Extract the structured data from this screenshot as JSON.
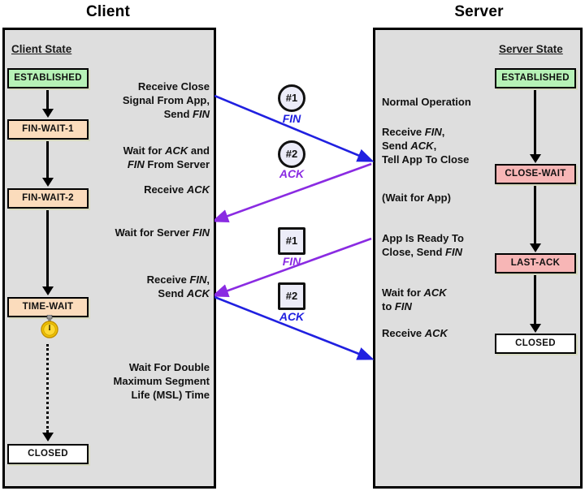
{
  "titles": {
    "client": "Client",
    "server": "Server"
  },
  "headings": {
    "client_state": "Client State",
    "server_state": "Server State"
  },
  "client_states": [
    {
      "label": "ESTABLISHED"
    },
    {
      "label": "FIN-WAIT-1"
    },
    {
      "label": "FIN-WAIT-2"
    },
    {
      "label": "TIME-WAIT"
    },
    {
      "label": "CLOSED"
    }
  ],
  "server_states": [
    {
      "label": "ESTABLISHED"
    },
    {
      "label": "CLOSE-WAIT"
    },
    {
      "label": "LAST-ACK"
    },
    {
      "label": "CLOSED"
    }
  ],
  "client_notes": [
    {
      "lines": [
        "Receive Close",
        "Signal From App,",
        "Send FIN"
      ]
    },
    {
      "lines": [
        "Wait for ACK and",
        "FIN From Server"
      ]
    },
    {
      "lines": [
        "Receive ACK"
      ]
    },
    {
      "lines": [
        "Wait for Server FIN"
      ]
    },
    {
      "lines": [
        "Receive FIN,",
        "Send ACK"
      ]
    },
    {
      "lines": [
        "Wait For Double",
        "Maximum Segment",
        "Life (MSL) Time"
      ]
    }
  ],
  "server_notes": [
    {
      "lines": [
        "Normal Operation"
      ]
    },
    {
      "lines": [
        "Receive FIN,",
        "Send ACK,",
        "Tell App To Close"
      ]
    },
    {
      "lines": [
        "(Wait for App)"
      ]
    },
    {
      "lines": [
        "App Is Ready To",
        "Close, Send FIN"
      ]
    },
    {
      "lines": [
        "Wait for ACK",
        "to FIN"
      ]
    },
    {
      "lines": [
        "Receive ACK"
      ]
    }
  ],
  "messages": [
    {
      "marker": "#1",
      "label": "FIN",
      "shape": "circle",
      "direction": "client-to-server",
      "color": "#2020e0"
    },
    {
      "marker": "#2",
      "label": "ACK",
      "shape": "circle",
      "direction": "server-to-client",
      "color": "#8a2be2"
    },
    {
      "marker": "#1",
      "label": "FIN",
      "shape": "square",
      "direction": "server-to-client",
      "color": "#8a2be2"
    },
    {
      "marker": "#2",
      "label": "ACK",
      "shape": "square",
      "direction": "client-to-server",
      "color": "#2020e0"
    }
  ],
  "icons": {
    "stopwatch": "stopwatch-icon"
  },
  "colors": {
    "established": "#b6f2b6",
    "fin_wait": "#fbdcbc",
    "time_wait": "#fbdcbc",
    "close_wait": "#f7b6b6",
    "last_ack": "#f7b6b6",
    "closed": "#ffffff",
    "panel_bg": "#dedede",
    "blue_msg": "#2020e0",
    "purple_msg": "#8a2be2"
  }
}
